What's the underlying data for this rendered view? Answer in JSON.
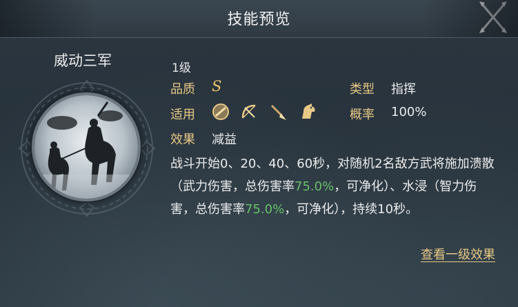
{
  "window": {
    "title": "技能预览",
    "close_icon": "crossed-blades-close-icon"
  },
  "skill": {
    "name": "威动三军",
    "level": "1级",
    "quality_label": "品质",
    "quality_value": "S",
    "type_label": "类型",
    "type_value": "指挥",
    "applicable_label": "适用",
    "applicable_icons": [
      "shield-icon",
      "bow-icon",
      "spear-icon",
      "horse-icon"
    ],
    "probability_label": "概率",
    "probability_value": "100%",
    "effect_label": "效果",
    "effect_value": "减益",
    "description": {
      "part1": "战斗开始0、20、40、60秒，对随机2名敌方武将施加溃散（武力伤害，总伤害率",
      "rate1": "75.0%",
      "part2": "，可净化）、水浸（智力伤害，总伤害率",
      "rate2": "75.0%",
      "part3": "，可净化），持续10秒。"
    },
    "detail_link": "查看一级效果"
  },
  "colors": {
    "label_gold": "#e8c886",
    "highlight_green": "#68c06b",
    "text_white": "#ececec"
  }
}
